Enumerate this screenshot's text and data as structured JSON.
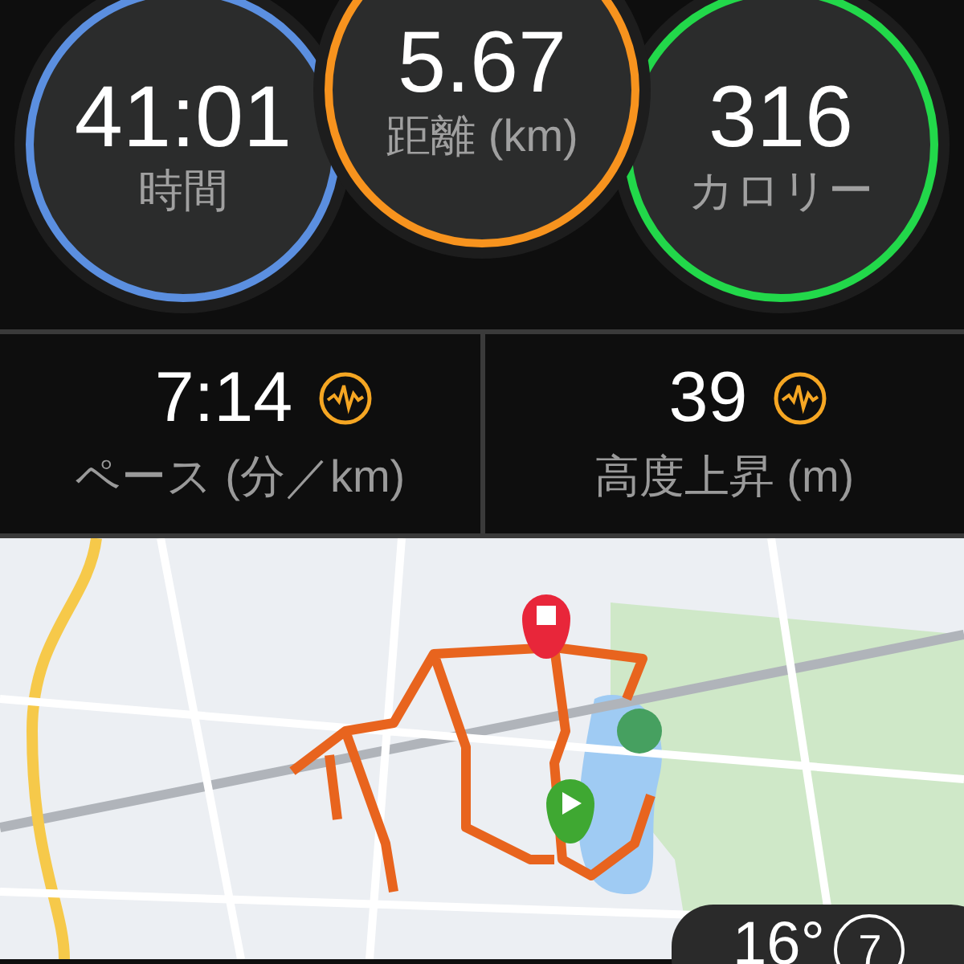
{
  "summary": [
    {
      "value": "41:01",
      "label": "時間",
      "color": "#5b8fe0"
    },
    {
      "value": "5.67",
      "label": "距離 (km)",
      "color": "#f7931e"
    },
    {
      "value": "316",
      "label": "カロリー",
      "color": "#22d84a"
    }
  ],
  "stats": [
    {
      "value": "7:14",
      "label": "ペース (分／km)"
    },
    {
      "value": "39",
      "label": "高度上昇 (m)"
    }
  ],
  "weather": {
    "temperature": "16°",
    "wind": "7"
  }
}
